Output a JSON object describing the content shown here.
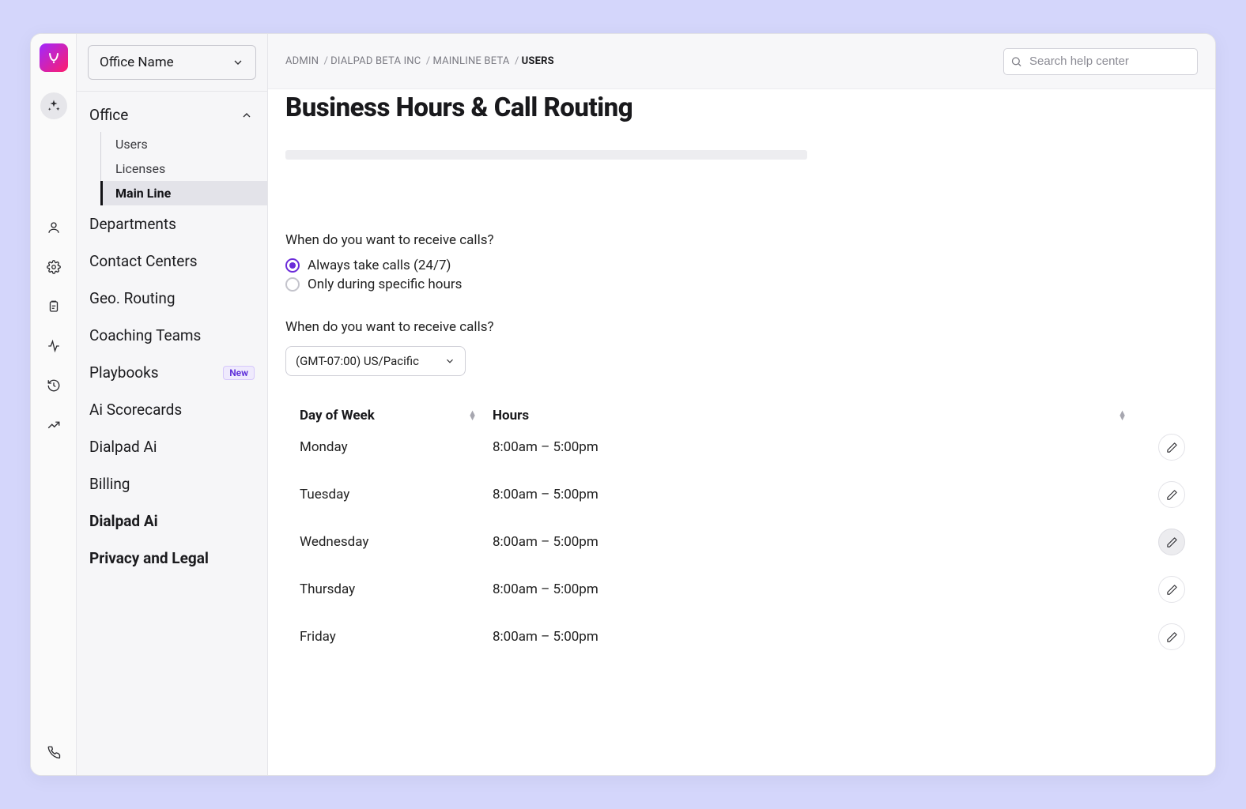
{
  "office_select": {
    "label": "Office Name"
  },
  "nav": {
    "section": "Office",
    "sub": [
      "Users",
      "Licenses",
      "Main Line"
    ],
    "active_sub": 2,
    "items": [
      {
        "label": "Departments"
      },
      {
        "label": "Contact Centers"
      },
      {
        "label": "Geo. Routing"
      },
      {
        "label": "Coaching Teams"
      },
      {
        "label": "Playbooks",
        "badge": "New"
      },
      {
        "label": "Ai Scorecards"
      },
      {
        "label": "Dialpad Ai"
      },
      {
        "label": "Billing"
      },
      {
        "label": "Dialpad Ai",
        "bold": true
      },
      {
        "label": "Privacy and Legal",
        "bold": true
      }
    ]
  },
  "breadcrumb": {
    "parts": [
      "ADMIN",
      "DIALPAD BETA INC",
      "MAINLINE BETA"
    ],
    "current": "USERS"
  },
  "search": {
    "placeholder": "Search help center"
  },
  "page": {
    "title": "Business Hours & Call Routing",
    "question1": "When do you want to receive calls?",
    "radios": [
      {
        "label": "Always take calls (24/7)",
        "checked": true
      },
      {
        "label": "Only during specific hours",
        "checked": false
      }
    ],
    "question2": "When do you want to receive calls?",
    "timezone": "(GMT-07:00) US/Pacific",
    "table": {
      "head_day": "Day of Week",
      "head_hours": "Hours",
      "rows": [
        {
          "day": "Monday",
          "hours": "8:00am – 5:00pm"
        },
        {
          "day": "Tuesday",
          "hours": "8:00am – 5:00pm"
        },
        {
          "day": "Wednesday",
          "hours": "8:00am – 5:00pm",
          "hover": true
        },
        {
          "day": "Thursday",
          "hours": "8:00am – 5:00pm"
        },
        {
          "day": "Friday",
          "hours": "8:00am – 5:00pm"
        }
      ]
    }
  }
}
